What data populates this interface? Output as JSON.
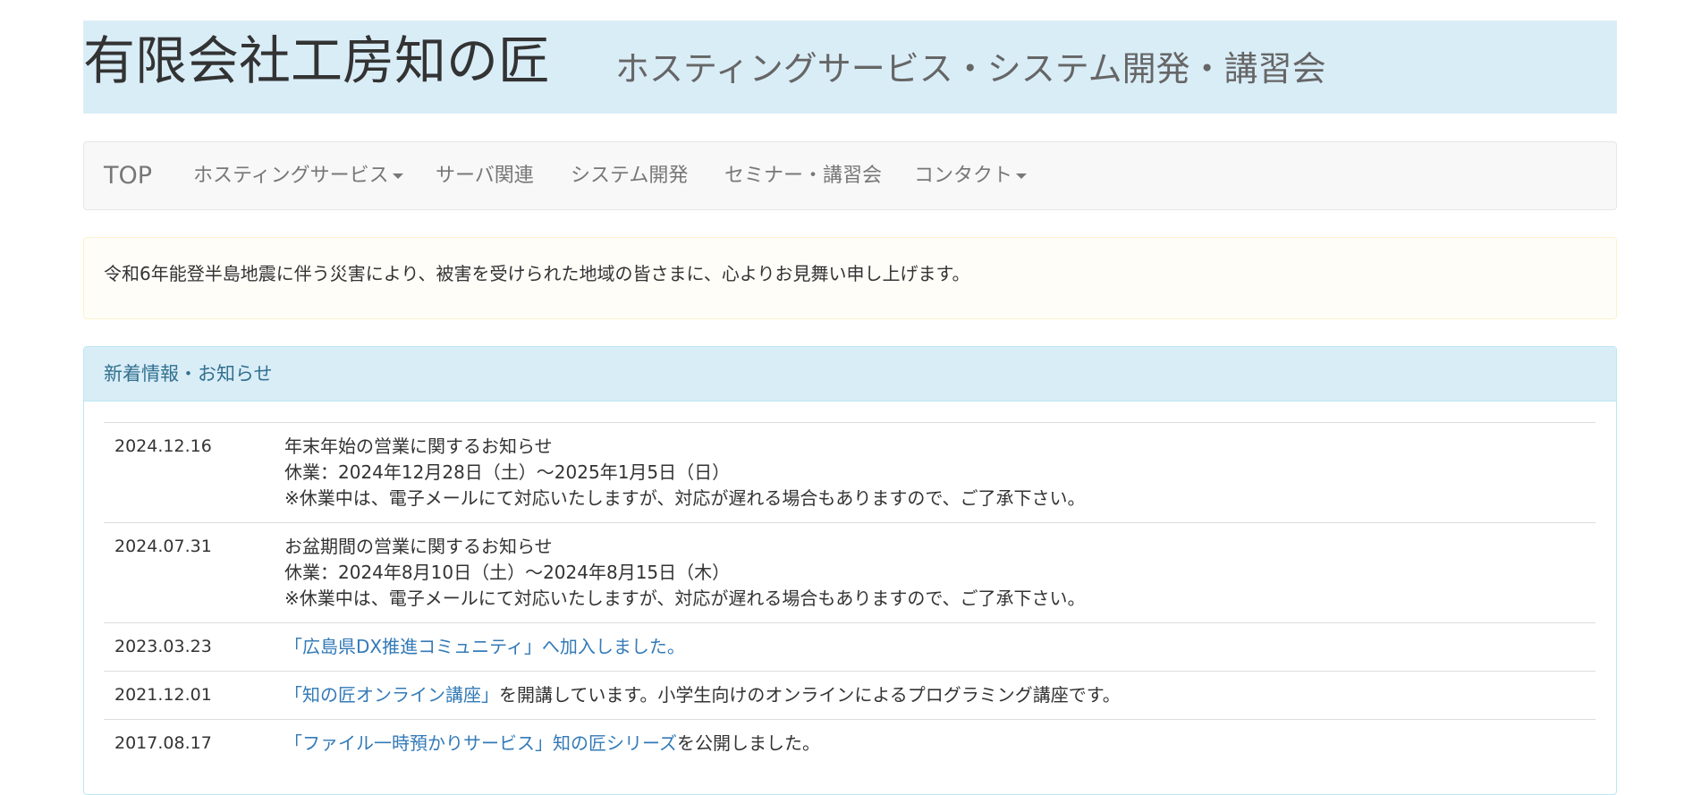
{
  "header": {
    "brand": "有限会社工房知の匠",
    "tagline": "ホスティングサービス・システム開発・講習会"
  },
  "nav": {
    "top": "TOP",
    "items": [
      {
        "label": "ホスティングサービス",
        "dropdown": true
      },
      {
        "label": "サーバ関連",
        "dropdown": false
      },
      {
        "label": "システム開発",
        "dropdown": false
      },
      {
        "label": "セミナー・講習会",
        "dropdown": false
      },
      {
        "label": "コンタクト",
        "dropdown": true
      }
    ]
  },
  "alert": {
    "text": "令和6年能登半島地震に伴う災害により、被害を受けられた地域の皆さまに、心よりお見舞い申し上げます。"
  },
  "news": {
    "title": "新着情報・お知らせ",
    "items": [
      {
        "date": "2024.12.16",
        "line1": "年末年始の営業に関するお知らせ",
        "line2": "休業：2024年12月28日（土）～2025年1月5日（日）",
        "line3": "※休業中は、電子メールにて対応いたしますが、対応が遅れる場合もありますので、ご了承下さい。"
      },
      {
        "date": "2024.07.31",
        "line1": "お盆期間の営業に関するお知らせ",
        "line2": "休業：2024年8月10日（土）～2024年8月15日（木）",
        "line3": "※休業中は、電子メールにて対応いたしますが、対応が遅れる場合もありますので、ご了承下さい。"
      },
      {
        "date": "2023.03.23",
        "link": "「広島県DX推進コミュニティ」へ加入しました。",
        "rest": ""
      },
      {
        "date": "2021.12.01",
        "link": "「知の匠オンライン講座」",
        "rest": "を開講しています。小学生向けのオンラインによるプログラミング講座です。"
      },
      {
        "date": "2017.08.17",
        "link": "「ファイル一時預かりサービス」知の匠シリーズ",
        "rest": "を公開しました。"
      }
    ]
  }
}
